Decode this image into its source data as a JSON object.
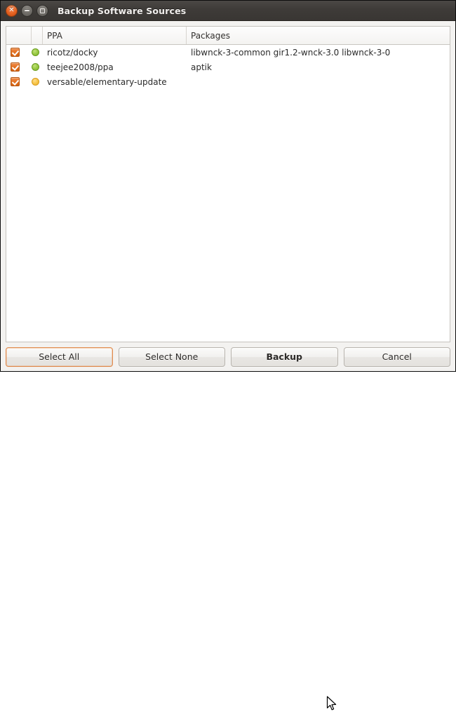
{
  "window": {
    "title": "Backup Software Sources",
    "controls": {
      "close": "close-button",
      "minimize": "minimize-button",
      "maximize": "maximize-button"
    }
  },
  "table": {
    "headers": {
      "check": "",
      "status": "",
      "ppa": "PPA",
      "packages": "Packages"
    },
    "rows": [
      {
        "checked": true,
        "status_color": "#9ccc48",
        "status_name": "green",
        "ppa": "ricotz/docky",
        "packages": "libwnck-3-common gir1.2-wnck-3.0 libwnck-3-0"
      },
      {
        "checked": true,
        "status_color": "#9ccc48",
        "status_name": "green",
        "ppa": "teejee2008/ppa",
        "packages": "aptik"
      },
      {
        "checked": true,
        "status_color": "#f7c84f",
        "status_name": "yellow",
        "ppa": "versable/elementary-update",
        "packages": ""
      }
    ]
  },
  "buttons": {
    "select_all": "Select All",
    "select_none": "Select None",
    "backup": "Backup",
    "cancel": "Cancel"
  },
  "colors": {
    "titlebar": "#3e3b38",
    "accent_orange": "#e2701f",
    "focus_ring": "#e08b4e",
    "list_background": "#ffffff",
    "dialog_background": "#f3f2f0"
  }
}
